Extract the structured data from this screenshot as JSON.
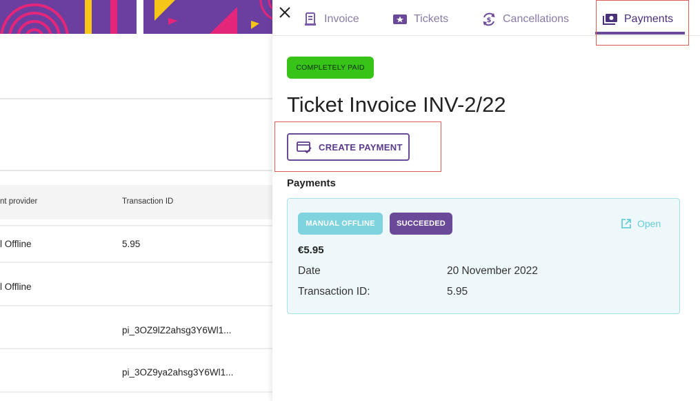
{
  "colors": {
    "brand_purple": "#6a4a98",
    "paid_green": "#37c318",
    "manual_chip": "#7ed3df",
    "card_bg": "#eef8fa",
    "highlight_red": "#e05a5a"
  },
  "background_page": {
    "table": {
      "headers": [
        "nt provider",
        "Transaction ID"
      ],
      "rows": [
        {
          "provider": "l Offline",
          "transaction_id": "5.95"
        },
        {
          "provider": "l Offline",
          "transaction_id": ""
        },
        {
          "provider": "",
          "transaction_id": "pi_3OZ9lZ2ahsg3Y6Wl1..."
        },
        {
          "provider": "",
          "transaction_id": "pi_3OZ9ya2ahsg3Y6Wl1..."
        }
      ]
    }
  },
  "drawer": {
    "close_icon": "close-icon",
    "tabs": [
      {
        "label": "Invoice",
        "icon": "receipt-icon",
        "active": false
      },
      {
        "label": "Tickets",
        "icon": "ticket-icon",
        "active": false
      },
      {
        "label": "Cancellations",
        "icon": "refund-icon",
        "active": false
      },
      {
        "label": "Payments",
        "icon": "money-icon",
        "active": true
      }
    ],
    "status_badge": "COMPLETELY PAID",
    "title": "Ticket Invoice INV-2/22",
    "create_payment_label": "CREATE PAYMENT",
    "payments_heading": "Payments",
    "payment": {
      "provider_chip": "MANUAL OFFLINE",
      "status_chip": "SUCCEEDED",
      "open_label": "Open",
      "amount": "€5.95",
      "date_label": "Date",
      "date_value": "20 November 2022",
      "txn_label": "Transaction ID:",
      "txn_value": "5.95"
    }
  }
}
